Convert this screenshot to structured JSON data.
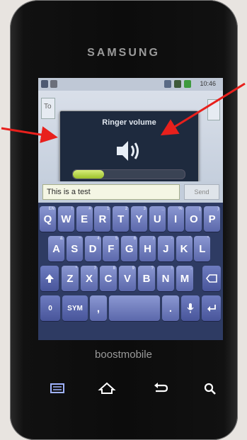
{
  "device": {
    "brand": "SAMSUNG",
    "carrier_logo": "boostmobile"
  },
  "status_bar": {
    "time": "10:46",
    "icons": [
      "contact-notification-icon",
      "message-notification-icon",
      "vibrate-icon",
      "signal-icon",
      "battery-icon"
    ]
  },
  "conversation": {
    "to_hint": "To"
  },
  "volume_dialog": {
    "title": "Ringer volume",
    "icon": "speaker-icon",
    "level": 0.28
  },
  "compose": {
    "message_text": "This is a test",
    "send_label": "Send"
  },
  "keyboard": {
    "row1": [
      {
        "k": "Q",
        "alt": "EN"
      },
      {
        "k": "W",
        "alt": "!"
      },
      {
        "k": "E",
        "alt": "#"
      },
      {
        "k": "R",
        "alt": "1"
      },
      {
        "k": "T",
        "alt": "2"
      },
      {
        "k": "Y",
        "alt": "3"
      },
      {
        "k": "U",
        "alt": "_"
      },
      {
        "k": "I",
        "alt": "%"
      },
      {
        "k": "O",
        "alt": "("
      },
      {
        "k": "P",
        "alt": ")"
      }
    ],
    "row2": [
      {
        "k": "A",
        "alt": "&"
      },
      {
        "k": "S",
        "alt": "~"
      },
      {
        "k": "D",
        "alt": "4"
      },
      {
        "k": "F",
        "alt": "5"
      },
      {
        "k": "G",
        "alt": "6"
      },
      {
        "k": "H",
        "alt": "/"
      },
      {
        "k": "J",
        "alt": "-"
      },
      {
        "k": "K",
        "alt": "'"
      },
      {
        "k": "L",
        "alt": "\""
      }
    ],
    "row3": [
      {
        "k": "Z",
        "alt": "*"
      },
      {
        "k": "X",
        "alt": "7"
      },
      {
        "k": "C",
        "alt": "8"
      },
      {
        "k": "V",
        "alt": "9"
      },
      {
        "k": "B",
        "alt": "?"
      },
      {
        "k": "N",
        "alt": "!"
      },
      {
        "k": "M",
        "alt": "."
      }
    ],
    "shift_icon": "shift-arrow-icon",
    "backspace_icon": "backspace-icon",
    "sym_label": "SYM",
    "comma": ",",
    "period": ".",
    "digit_key": "0",
    "mic_icon": "microphone-icon",
    "enter_icon": "enter-icon"
  },
  "nav_buttons": [
    "menu-icon",
    "home-icon",
    "back-icon",
    "search-icon"
  ],
  "colors": {
    "keyboard_bg": "#2e3b63",
    "key_top": "#8b98d2",
    "dialog_bg": "#1e2a3e",
    "volume_fill": "#b8d640",
    "annotation_arrow": "#e8201c"
  }
}
